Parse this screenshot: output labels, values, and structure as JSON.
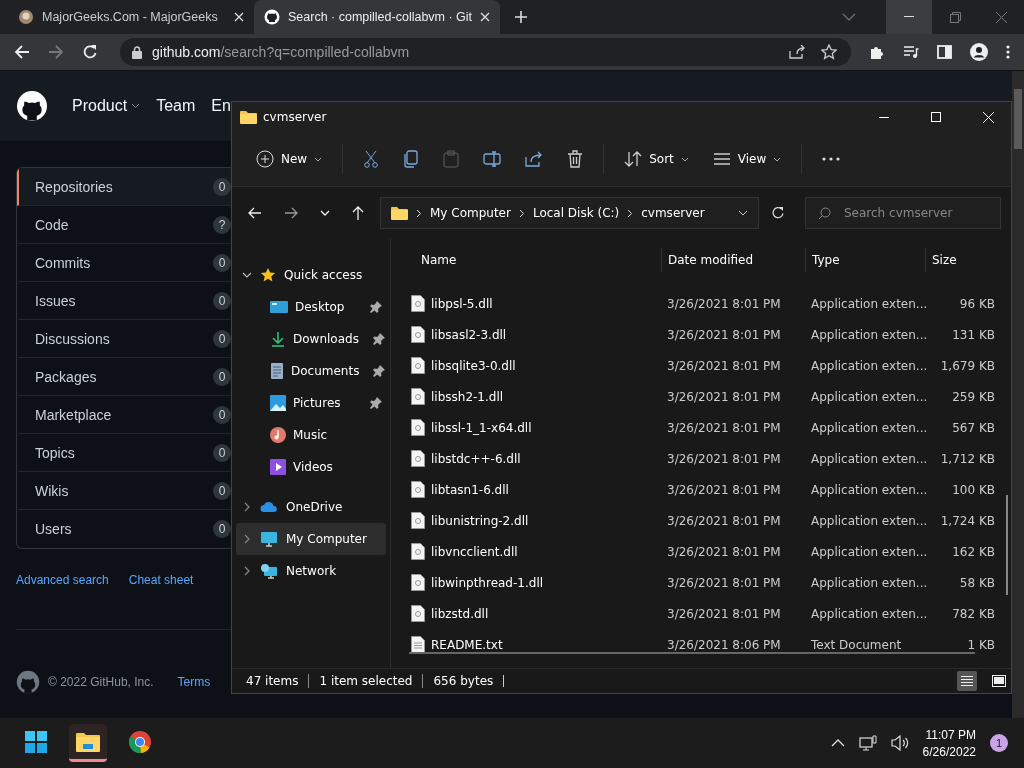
{
  "browser": {
    "tabs": [
      {
        "title": "MajorGeeks.Com - MajorGeeks",
        "selected": false
      },
      {
        "title": "Search · compilled-collabvm · Git",
        "selected": true
      }
    ],
    "url_host": "github.com",
    "url_path": "/search?q=compilled-collabvm"
  },
  "github": {
    "nav": [
      "Product",
      "Team",
      "En"
    ],
    "filters": [
      {
        "label": "Repositories",
        "count": "0",
        "selected": true
      },
      {
        "label": "Code",
        "count": "?",
        "selected": false
      },
      {
        "label": "Commits",
        "count": "0",
        "selected": false
      },
      {
        "label": "Issues",
        "count": "0",
        "selected": false
      },
      {
        "label": "Discussions",
        "count": "0",
        "selected": false
      },
      {
        "label": "Packages",
        "count": "0",
        "selected": false
      },
      {
        "label": "Marketplace",
        "count": "0",
        "selected": false
      },
      {
        "label": "Topics",
        "count": "0",
        "selected": false
      },
      {
        "label": "Wikis",
        "count": "0",
        "selected": false
      },
      {
        "label": "Users",
        "count": "0",
        "selected": false
      }
    ],
    "links": [
      "Advanced search",
      "Cheat sheet"
    ],
    "footer": {
      "copyright": "© 2022 GitHub, Inc.",
      "links": [
        "Terms"
      ]
    }
  },
  "explorer": {
    "title": "cvmserver",
    "commands": [
      {
        "kind": "new",
        "label": "New",
        "disabled": false
      },
      {
        "kind": "cut",
        "disabled": false
      },
      {
        "kind": "copy",
        "disabled": false
      },
      {
        "kind": "paste",
        "disabled": true
      },
      {
        "kind": "rename",
        "disabled": false
      },
      {
        "kind": "share",
        "disabled": false
      },
      {
        "kind": "delete",
        "disabled": false
      },
      {
        "kind": "sort",
        "label": "Sort",
        "disabled": false
      },
      {
        "kind": "view",
        "label": "View",
        "disabled": false
      },
      {
        "kind": "more",
        "disabled": false
      }
    ],
    "breadcrumb": [
      "My Computer",
      "Local Disk (C:)",
      "cvmserver"
    ],
    "search": {
      "placeholder": "Search cvmserver"
    },
    "nav": [
      {
        "kind": "star",
        "label": "Quick access",
        "expanded": true,
        "selected": false,
        "children": [
          {
            "kind": "desktop",
            "label": "Desktop",
            "pinned": true
          },
          {
            "kind": "downloads",
            "label": "Downloads",
            "pinned": true
          },
          {
            "kind": "documents",
            "label": "Documents",
            "pinned": true
          },
          {
            "kind": "pictures",
            "label": "Pictures",
            "pinned": true
          },
          {
            "kind": "music",
            "label": "Music",
            "pinned": false
          },
          {
            "kind": "videos",
            "label": "Videos",
            "pinned": false
          }
        ]
      },
      {
        "kind": "cloud",
        "label": "OneDrive",
        "expanded": false,
        "selected": false
      },
      {
        "kind": "computer",
        "label": "My Computer",
        "expanded": false,
        "selected": true
      },
      {
        "kind": "network",
        "label": "Network",
        "expanded": false,
        "selected": false
      }
    ],
    "columns": [
      "Name",
      "Date modified",
      "Type",
      "Size"
    ],
    "files": [
      {
        "kind": "dll",
        "name": "libpsl-5.dll",
        "date": "3/26/2021 8:01 PM",
        "type": "Application exten...",
        "size": "96 KB"
      },
      {
        "kind": "dll",
        "name": "libsasl2-3.dll",
        "date": "3/26/2021 8:01 PM",
        "type": "Application exten...",
        "size": "131 KB"
      },
      {
        "kind": "dll",
        "name": "libsqlite3-0.dll",
        "date": "3/26/2021 8:01 PM",
        "type": "Application exten...",
        "size": "1,679 KB"
      },
      {
        "kind": "dll",
        "name": "libssh2-1.dll",
        "date": "3/26/2021 8:01 PM",
        "type": "Application exten...",
        "size": "259 KB"
      },
      {
        "kind": "dll",
        "name": "libssl-1_1-x64.dll",
        "date": "3/26/2021 8:01 PM",
        "type": "Application exten...",
        "size": "567 KB"
      },
      {
        "kind": "dll",
        "name": "libstdc++-6.dll",
        "date": "3/26/2021 8:01 PM",
        "type": "Application exten...",
        "size": "1,712 KB"
      },
      {
        "kind": "dll",
        "name": "libtasn1-6.dll",
        "date": "3/26/2021 8:01 PM",
        "type": "Application exten...",
        "size": "100 KB"
      },
      {
        "kind": "dll",
        "name": "libunistring-2.dll",
        "date": "3/26/2021 8:01 PM",
        "type": "Application exten...",
        "size": "1,724 KB"
      },
      {
        "kind": "dll",
        "name": "libvncclient.dll",
        "date": "3/26/2021 8:01 PM",
        "type": "Application exten...",
        "size": "162 KB"
      },
      {
        "kind": "dll",
        "name": "libwinpthread-1.dll",
        "date": "3/26/2021 8:01 PM",
        "type": "Application exten...",
        "size": "58 KB"
      },
      {
        "kind": "dll",
        "name": "libzstd.dll",
        "date": "3/26/2021 8:01 PM",
        "type": "Application exten...",
        "size": "782 KB"
      },
      {
        "kind": "txt",
        "name": "README.txt",
        "date": "3/26/2021 8:06 PM",
        "type": "Text Document",
        "size": "1 KB"
      }
    ],
    "status": [
      "47 items",
      "1 item selected",
      "656 bytes"
    ],
    "views": [
      {
        "kind": "details",
        "selected": true
      },
      {
        "kind": "tiles",
        "selected": false
      }
    ]
  },
  "taskbar": {
    "apps": [
      {
        "kind": "start",
        "active": false
      },
      {
        "kind": "folder",
        "active": true
      },
      {
        "kind": "chrome",
        "active": false
      }
    ],
    "time": "11:07 PM",
    "date": "6/26/2022",
    "notifications": "1"
  }
}
